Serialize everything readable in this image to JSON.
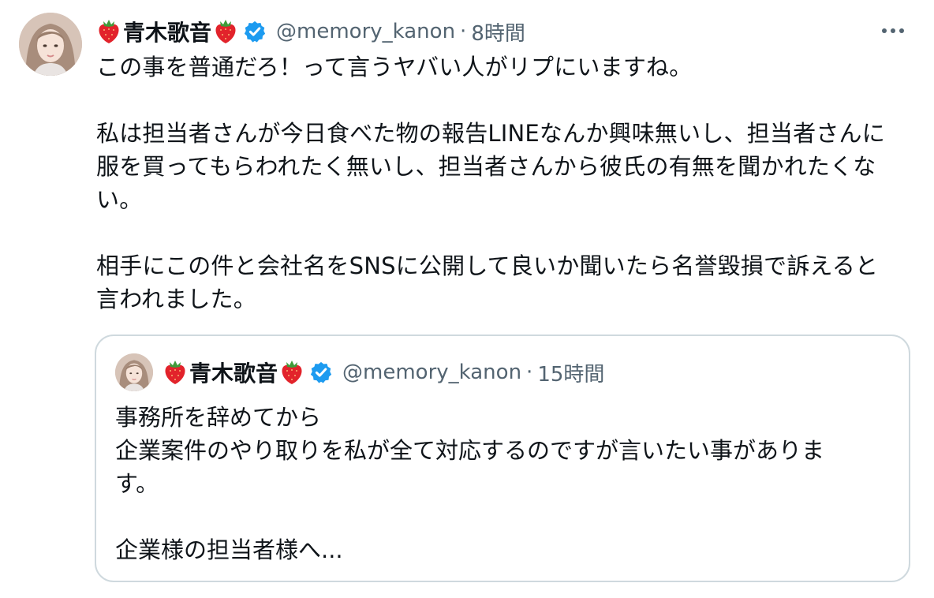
{
  "tweet": {
    "display_name": "青木歌音",
    "handle": "@memory_kanon",
    "separator": "·",
    "time": "8時間",
    "body": {
      "p1": "この事を普通だろ！って言うヤバい人がリプにいますね。",
      "p2_line1": "私は担当者さんが今日食べた物の報告LINEなんか興味無いし、担当者さんに",
      "p2_line2": "服を買ってもらわれたく無いし、担当者さんから彼氏の有無を聞かれたくな",
      "p2_line3": "い。",
      "p3_line1": "相手にこの件と会社名をSNSに公開して良いか聞いたら名誉毀損で訴えると",
      "p3_line2": "言われました。"
    }
  },
  "quoted_tweet": {
    "display_name": "青木歌音",
    "handle": "@memory_kanon",
    "separator": "·",
    "time": "15時間",
    "body": {
      "line1": "事務所を辞めてから",
      "line2": "企業案件のやり取りを私が全て対応するのですが言いたい事がありま",
      "line3": "す。",
      "line4": "企業様の担当者様へ..."
    }
  },
  "icons": {
    "avatar": "profile-photo",
    "name_emoji": "strawberry-icon",
    "verified": "verified-badge-icon",
    "more": "more-options-icon"
  },
  "colors": {
    "text": "#0f1419",
    "secondary_text": "#536471",
    "verified_blue": "#1d9bf0",
    "border": "#cfd9de",
    "strawberry_red": "#e2232b"
  }
}
